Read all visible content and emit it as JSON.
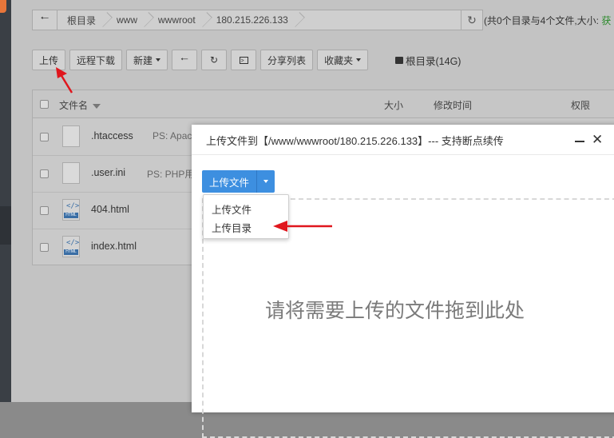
{
  "pathbar": {
    "crumbs": [
      "根目录",
      "www",
      "wwwroot",
      "180.215.226.133"
    ],
    "summary_prefix": "(共0个目录与4个文件,大小: ",
    "summary_link": "获"
  },
  "toolbar": {
    "upload": "上传",
    "remote_download": "远程下载",
    "new": "新建",
    "share_list": "分享列表",
    "favorites": "收藏夹",
    "disk": "根目录(14G)"
  },
  "table": {
    "headers": {
      "name": "文件名",
      "size": "大小",
      "modified": "修改时间",
      "perm": "权限"
    },
    "rows": [
      {
        "name": ".htaccess",
        "ps": "PS: Apac",
        "type": "file"
      },
      {
        "name": ".user.ini",
        "ps": "PS: PHP用",
        "type": "file"
      },
      {
        "name": "404.html",
        "ps": "",
        "type": "html"
      },
      {
        "name": "index.html",
        "ps": "",
        "type": "html"
      }
    ]
  },
  "dialog": {
    "title": "上传文件到【/www/wwwroot/180.215.226.133】--- 支持断点续传",
    "upload_button": "上传文件",
    "menu": [
      "上传文件",
      "上传目录"
    ],
    "drop_text": "请将需要上传的文件拖到此处"
  },
  "icons": {
    "html_tag": "HTML",
    "html_code": "</>"
  },
  "colors": {
    "primary": "#3d8fe0",
    "arrow": "#e0161d",
    "link": "#2a8a2a"
  }
}
